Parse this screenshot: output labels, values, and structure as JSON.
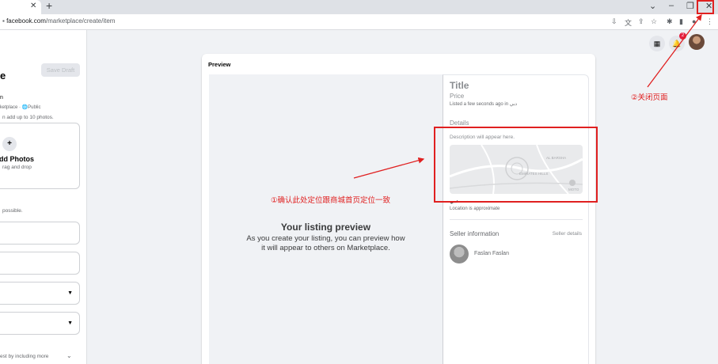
{
  "browser": {
    "tab_close": "✕",
    "new_tab": "+",
    "url_domain": "facebook.com",
    "url_path": "/marketplace/create/item",
    "window_controls": [
      "⌄",
      "–",
      "❐",
      "✕"
    ]
  },
  "left_panel": {
    "save_draft": "Save Draft",
    "heading_tail": "e",
    "name_tail": "n",
    "marketplace_public": "ketplace · 🌐Public",
    "photos_hint": "n add up to 10 photos.",
    "add_photos": "dd Photos",
    "drag_drop": "rag and drop",
    "possible": "possible.",
    "best_hint": "est by including more"
  },
  "header_icons": {
    "badge_count": "2"
  },
  "preview": {
    "card_title": "Preview",
    "listing_heading": "Your listing preview",
    "listing_text": "As you create your listing, you can preview how it will appear to others on Marketplace.",
    "title": "Title",
    "price": "Price",
    "listed": "Listed a few seconds ago in دبي",
    "details": "Details",
    "description": "Description will appear here.",
    "map_labels": [
      "AL BARSHA",
      "EMIRATES HILLS",
      "MOTO"
    ],
    "location": "دبي",
    "location_approx": "Location is approximate",
    "seller_info": "Seller information",
    "seller_details": "Seller details",
    "seller_name": "Faslan Faslan"
  },
  "annotations": {
    "note1": "①确认此处定位跟商城首页定位一致",
    "note2": "②关闭页面",
    "color": "#e02020"
  }
}
